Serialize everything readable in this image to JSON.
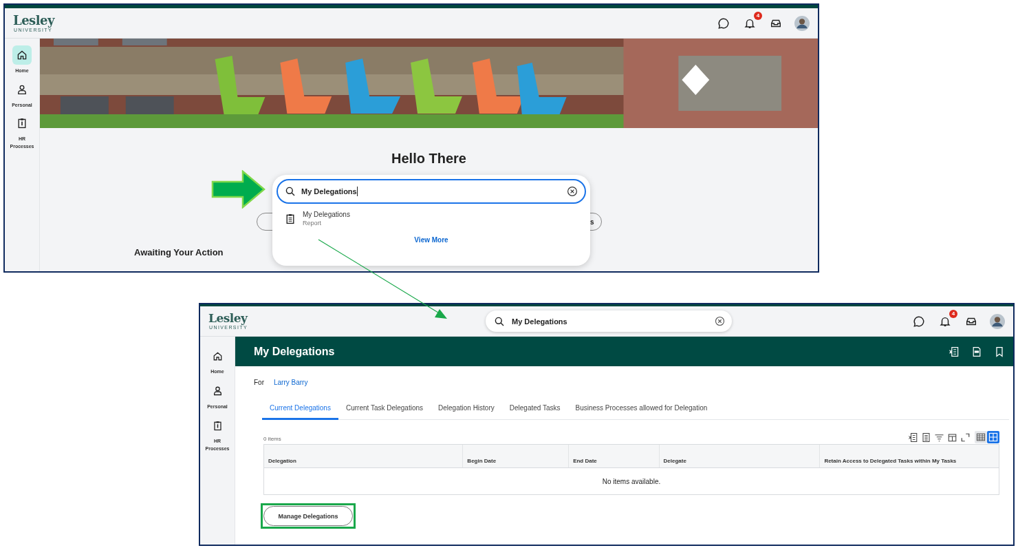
{
  "top_screen": {
    "logo": {
      "name": "Lesley",
      "tagline": "UNIVERSITY"
    },
    "notification_count": "4",
    "sidebar": [
      {
        "label": "Home",
        "selected": true
      },
      {
        "label": "Personal",
        "selected": false
      },
      {
        "label": "HR Processes",
        "selected": false
      }
    ],
    "greeting": "Hello There",
    "search": {
      "value": "My Delegations"
    },
    "results": [
      {
        "title": "My Delegations",
        "subtitle": "Report"
      }
    ],
    "view_more": "View More",
    "shortcut_fragment": "s",
    "section_heading": "Awaiting Your Action"
  },
  "bottom_screen": {
    "logo": {
      "name": "Lesley",
      "tagline": "UNIVERSITY"
    },
    "search": {
      "value": "My Delegations"
    },
    "notification_count": "4",
    "sidebar": [
      {
        "label": "Home",
        "selected": false
      },
      {
        "label": "Personal",
        "selected": false
      },
      {
        "label": "HR Processes",
        "selected": false
      }
    ],
    "title": "My Delegations",
    "for_label": "For",
    "for_value": "Larry Barry",
    "tabs": [
      {
        "label": "Current Delegations",
        "selected": true
      },
      {
        "label": "Current Task Delegations",
        "selected": false
      },
      {
        "label": "Delegation History",
        "selected": false
      },
      {
        "label": "Delegated Tasks",
        "selected": false
      },
      {
        "label": "Business Processes allowed for Delegation",
        "selected": false
      }
    ],
    "item_count": "0 items",
    "view_toggle": [
      {
        "selected": false
      },
      {
        "selected": true
      }
    ],
    "table": {
      "columns": [
        "Delegation",
        "Begin Date",
        "End Date",
        "Delegate",
        "Retain Access to Delegated Tasks within My Tasks"
      ],
      "empty_message": "No items available."
    },
    "action_button": "Manage Delegations"
  }
}
